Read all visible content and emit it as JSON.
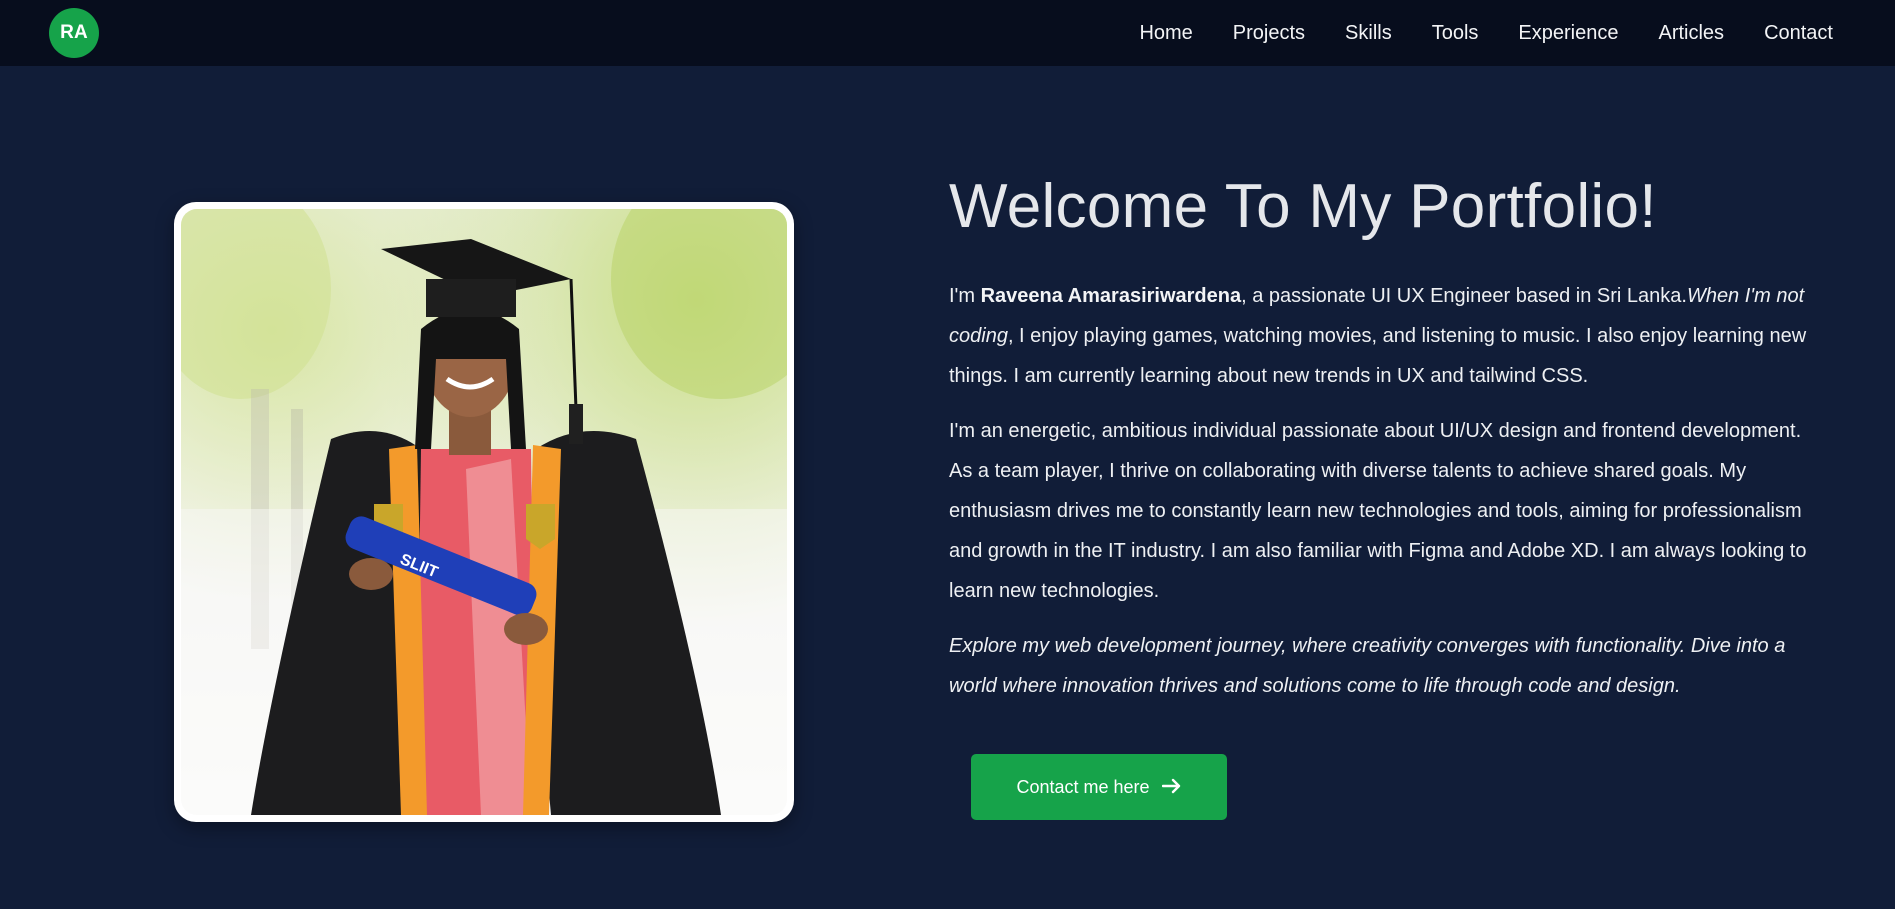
{
  "header": {
    "logo_text": "RA",
    "nav": [
      {
        "label": "Home"
      },
      {
        "label": "Projects"
      },
      {
        "label": "Skills"
      },
      {
        "label": "Tools"
      },
      {
        "label": "Experience"
      },
      {
        "label": "Articles"
      },
      {
        "label": "Contact"
      }
    ]
  },
  "hero": {
    "title": "Welcome To My Portfolio!",
    "intro": {
      "prefix": "I'm ",
      "name": "Raveena Amarasiriwardena",
      "middle": ", a passionate UI UX Engineer based in Sri Lanka.",
      "italic": "When I'm not coding",
      "suffix": ", I enjoy playing games, watching movies, and listening to music. I also enjoy learning new things. I am currently learning about new trends in UX and tailwind CSS."
    },
    "about": "I'm an energetic, ambitious individual passionate about UI/UX design and frontend development. As a team player, I thrive on collaborating with diverse talents to achieve shared goals. My enthusiasm drives me to constantly learn new technologies and tools, aiming for professionalism and growth in the IT industry. I am also familiar with Figma and Adobe XD. I am always looking to learn new technologies.",
    "tagline": "Explore my web development journey, where creativity converges with functionality. Dive into a world where innovation thrives and solutions come to life through code and design.",
    "cta_label": "Contact me here",
    "cta_icon": "arrow-right-icon"
  },
  "colors": {
    "page_bg": "#111d38",
    "header_bg": "#070d1d",
    "accent_green": "#16a34a",
    "text": "#e5e7eb"
  }
}
